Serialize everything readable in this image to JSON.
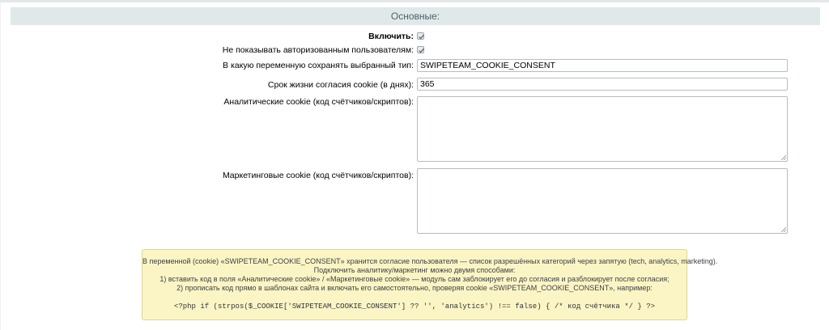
{
  "section": {
    "title": "Основные:"
  },
  "fields": {
    "enable": {
      "label": "Включить:",
      "checked": true
    },
    "hide_authorized": {
      "label": "Не показывать авторизованным пользователям:",
      "checked": true
    },
    "variable_name": {
      "label": "В какую переменную сохранять выбранный тип:",
      "value": "SWIPETEAM_COOKIE_CONSENT"
    },
    "lifetime": {
      "label": "Срок жизни согласия cookie (в днях):",
      "value": "365"
    },
    "analytics": {
      "label": "Аналитические cookie (код счётчиков/скриптов):",
      "value": ""
    },
    "marketing": {
      "label": "Маркетинговые cookie (код счётчиков/скриптов):",
      "value": ""
    }
  },
  "note": {
    "line1": "В переменной (cookie) «SWIPETEAM_COOKIE_CONSENT» хранится согласие пользователя — список разрешённых категорий через запятую (tech, analytics, marketing).",
    "line2": "Подключить аналитику/маркетинг можно двумя способами:",
    "line3": "1) вставить код в поля «Аналитические cookie» / «Маркетинговые cookie» — модуль сам заблокирует его до согласия и разблокирует после согласия;",
    "line4": "2) прописать код прямо в шаблонах сайта и включать его самостоятельно, проверяя cookie «SWIPETEAM_COOKIE_CONSENT», например:",
    "code": "<?php if (strpos($_COOKIE['SWIPETEAM_COOKIE_CONSENT'] ?? '', 'analytics') !== false) { /* код счётчика */ } ?>"
  }
}
